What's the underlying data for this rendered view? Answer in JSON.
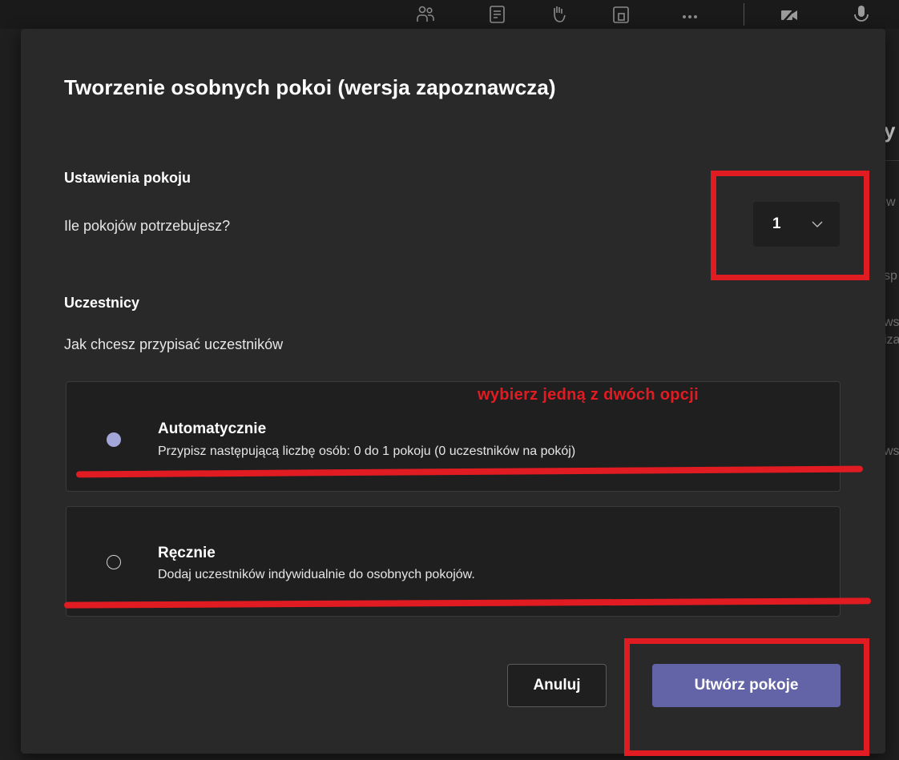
{
  "toolbar": {
    "icons": [
      "participants-icon",
      "chat-icon",
      "raise-hand-icon",
      "rooms-icon",
      "more-icon",
      "camera-off-icon",
      "microphone-icon"
    ]
  },
  "background": {
    "fragments": [
      "y",
      "w",
      "sp",
      "ws",
      "iza",
      "ws"
    ]
  },
  "dialog": {
    "title": "Tworzenie osobnych pokoi (wersja zapoznawcza)",
    "room_settings": {
      "heading": "Ustawienia pokoju",
      "question": "Ile pokojów potrzebujesz?",
      "room_count": "1"
    },
    "participants": {
      "heading": "Uczestnicy",
      "question": "Jak chcesz przypisać uczestników",
      "options": [
        {
          "title": "Automatycznie",
          "description": "Przypisz następującą liczbę osób: 0 do 1 pokoju (0 uczestników na pokój)",
          "selected": true
        },
        {
          "title": "Ręcznie",
          "description": "Dodaj uczestników indywidualnie do osobnych pokojów.",
          "selected": false
        }
      ]
    },
    "buttons": {
      "cancel": "Anuluj",
      "create": "Utwórz pokoje"
    }
  },
  "annotation": {
    "note": "wybierz jedną z dwóch opcji",
    "color": "#e01b22"
  },
  "colors": {
    "accent": "#6264a7",
    "radio_selected": "#a3a6d8",
    "dialog_bg": "#292929"
  }
}
